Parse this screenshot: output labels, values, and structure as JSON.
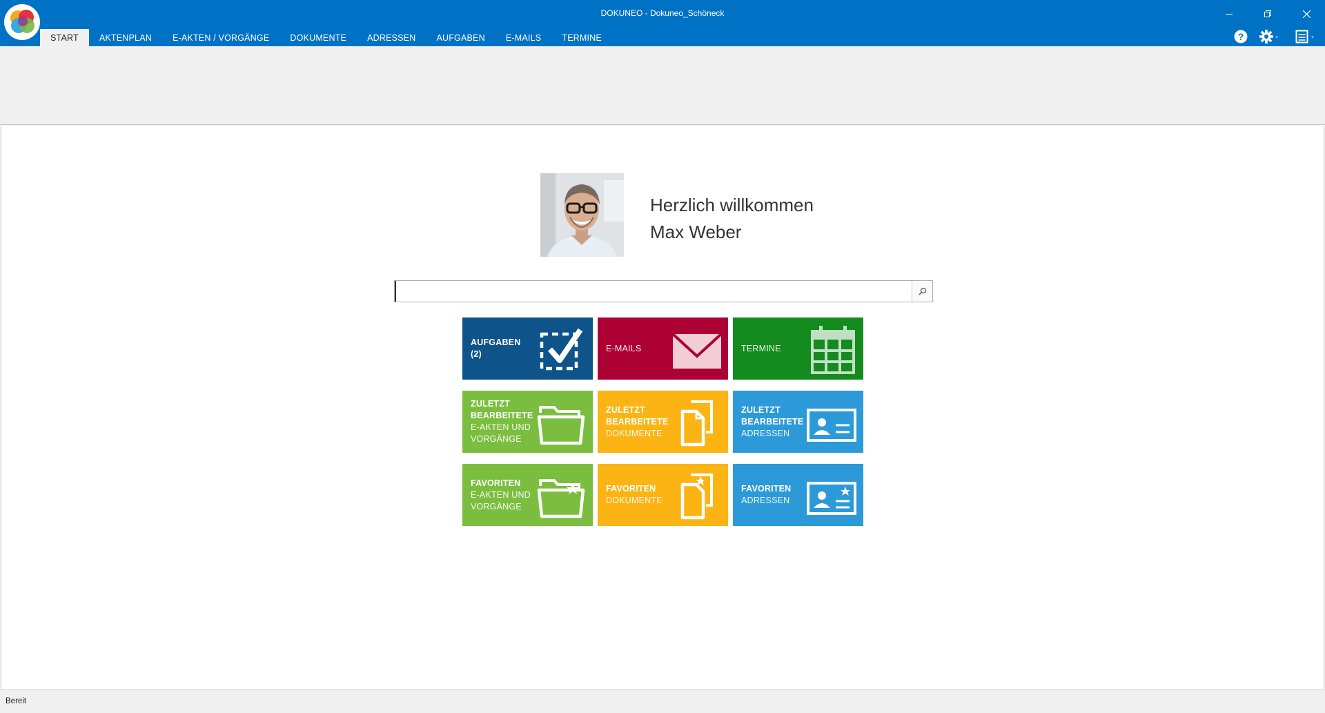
{
  "window": {
    "title": "DOKUNEO - Dokuneo_Schöneck",
    "controls": [
      "minimize-icon",
      "restore-icon",
      "close-icon"
    ]
  },
  "tabs": [
    {
      "label": "START",
      "active": true
    },
    {
      "label": "AKTENPLAN"
    },
    {
      "label": "E-AKTEN / VORGÄNGE"
    },
    {
      "label": "DOKUMENTE"
    },
    {
      "label": "ADRESSEN"
    },
    {
      "label": "AUFGABEN"
    },
    {
      "label": "E-MAILS"
    },
    {
      "label": "TERMINE"
    }
  ],
  "toolbar_icons": [
    "help-icon",
    "settings-icon",
    "layout-icon"
  ],
  "welcome": {
    "greeting": "Herzlich willkommen",
    "user": "Max Weber"
  },
  "search": {
    "value": "",
    "icon": "search-icon"
  },
  "tiles": [
    {
      "lines": [
        "AUFGABEN",
        "(2)"
      ],
      "sub": [],
      "icon": "checklist-icon",
      "color": "#0e5389"
    },
    {
      "lines": [
        "E-MAILS"
      ],
      "sub": [],
      "icon": "envelope-icon",
      "color": "#ad0035",
      "light": true
    },
    {
      "lines": [
        "TERMINE"
      ],
      "sub": [],
      "icon": "calendar-icon",
      "color": "#138b1e",
      "light": true
    },
    {
      "lines": [
        "ZULETZT",
        "BEARBEITETE"
      ],
      "sub": [
        "E-AKTEN UND",
        "VORGÄNGE"
      ],
      "icon": "folder-icon",
      "color": "#7bbe3f"
    },
    {
      "lines": [
        "ZULETZT",
        "BEARBEITETE"
      ],
      "sub": [
        "DOKUMENTE"
      ],
      "icon": "documents-icon",
      "color": "#fbb414"
    },
    {
      "lines": [
        "ZULETZT",
        "BEARBEITETE"
      ],
      "sub": [
        "ADRESSEN"
      ],
      "icon": "contact-card-icon",
      "color": "#2c9ad8"
    },
    {
      "lines": [
        "FAVORITEN"
      ],
      "sub": [
        "E-AKTEN UND",
        "VORGÄNGE"
      ],
      "icon": "folder-star-icon",
      "color": "#7bbe3f"
    },
    {
      "lines": [
        "FAVORITEN"
      ],
      "sub": [
        "DOKUMENTE"
      ],
      "icon": "documents-star-icon",
      "color": "#fbb414"
    },
    {
      "lines": [
        "FAVORITEN"
      ],
      "sub": [
        "ADRESSEN"
      ],
      "icon": "contact-card-star-icon",
      "color": "#2c9ad8"
    }
  ],
  "status": {
    "text": "Bereit"
  }
}
